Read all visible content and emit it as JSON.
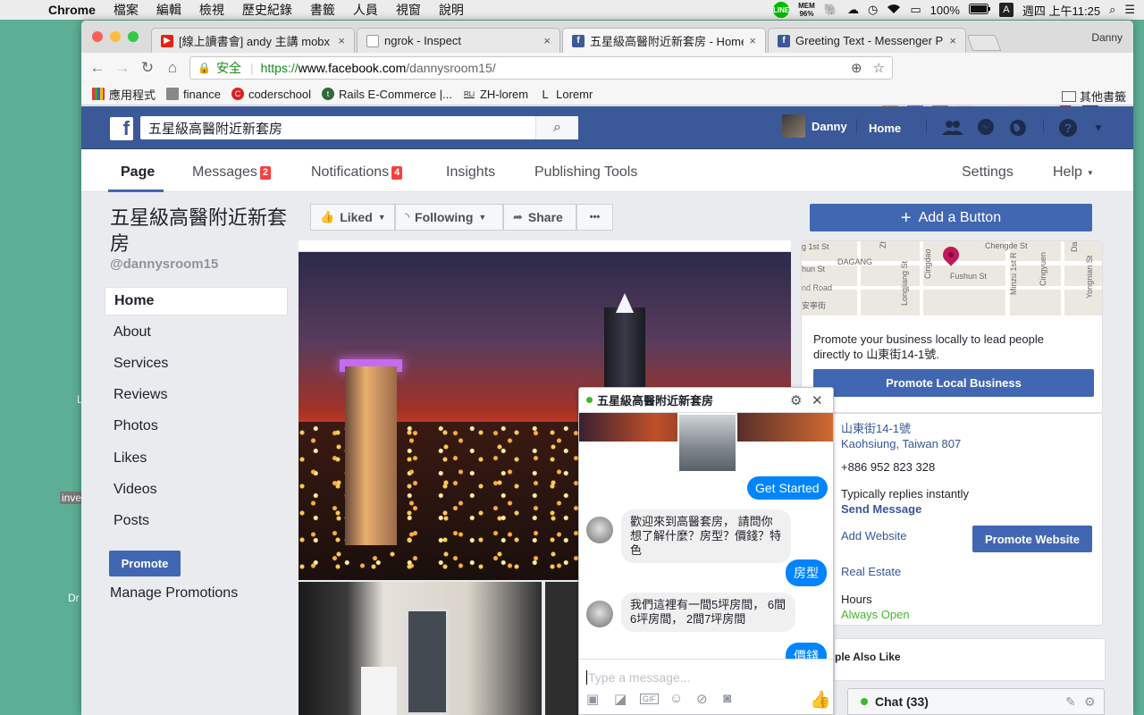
{
  "menubar": {
    "app": "Chrome",
    "items": [
      "檔案",
      "編輯",
      "檢視",
      "歷史紀錄",
      "書籤",
      "人員",
      "視窗",
      "說明"
    ],
    "line": "LINE",
    "mem_label": "MEM",
    "mem_value": "96%",
    "battery": "100%",
    "input_source": "A",
    "clock": "週四 上午11:25"
  },
  "desktop": {
    "labels": [
      "L",
      "inve",
      "Dr"
    ]
  },
  "browser": {
    "profile": "Danny",
    "tabs": [
      {
        "label": "[線上讀書會] andy 主講 mobx v",
        "icon": "youtube-icon",
        "color": "#e62117",
        "glyph": "▶",
        "active": false
      },
      {
        "label": "ngrok - Inspect",
        "icon": "page-icon",
        "color": "#9aa0a6",
        "glyph": "",
        "active": false
      },
      {
        "label": "五星級高醫附近新套房 - Home",
        "icon": "facebook-icon",
        "color": "#3b5998",
        "glyph": "f",
        "active": true
      },
      {
        "label": "Greeting Text - Messenger Pla",
        "icon": "facebook-icon",
        "color": "#3b5998",
        "glyph": "f",
        "active": false
      }
    ],
    "close_glyph": "×",
    "omnibox": {
      "secure_label": "安全",
      "protocol": "https://",
      "host": "www.facebook.com",
      "path": "/dannysroom15/"
    },
    "bookmarks": [
      {
        "label": "應用程式",
        "icon": "apps-grid-icon",
        "color": "#555"
      },
      {
        "label": "finance",
        "icon": "folder-icon",
        "color": "#777"
      },
      {
        "label": "coderschool",
        "icon": "coderschool-icon",
        "color": "#e02020"
      },
      {
        "label": "Rails E-Commerce |...",
        "icon": "rails-icon",
        "color": "#2f6b3a"
      },
      {
        "label": "ZH-lorem",
        "icon": "lorem-icon",
        "color": "#333"
      },
      {
        "label": "Loremr",
        "icon": "loremr-icon",
        "color": "#333"
      }
    ],
    "other_bookmarks": "其他書籤"
  },
  "fb": {
    "search_value": "五星級高醫附近新套房",
    "user_name": "Danny",
    "home_label": "Home",
    "page_nav": {
      "page": "Page",
      "messages": "Messages",
      "messages_count": "2",
      "notifications": "Notifications",
      "notifications_count": "4",
      "insights": "Insights",
      "publishing": "Publishing Tools",
      "settings": "Settings",
      "help": "Help"
    },
    "page": {
      "title": "五星級高醫附近新套房",
      "handle": "@dannysroom15",
      "nav": [
        "Home",
        "About",
        "Services",
        "Reviews",
        "Photos",
        "Likes",
        "Videos",
        "Posts"
      ],
      "promote": "Promote",
      "manage_promotions": "Manage Promotions"
    },
    "actions": {
      "liked": "Liked",
      "following": "Following",
      "share": "Share",
      "more": "•••",
      "add_button": "Add a Button"
    },
    "map": {
      "labels": [
        "g 1st St",
        "Chengde St",
        "DAGANG",
        "hun St",
        "Fushun St",
        "nd Road",
        "安寧街",
        "Zhiyou",
        "Longjiang St",
        "Cingdao",
        "Minzu 1st R",
        "Cingyuen",
        "Yongnian St",
        "Dalong"
      ]
    },
    "sidebar": {
      "promote_text": "Promote your business locally to lead people directly to 山東街14-1號.",
      "promote_local": "Promote Local Business",
      "address_line1": "山東街14-1號",
      "address_line2": "Kaohsiung, Taiwan 807",
      "phone": "+886 952 823 328",
      "replies": "Typically replies instantly",
      "send_message": "Send Message",
      "add_website": "Add Website",
      "promote_website": "Promote Website",
      "category": "Real Estate",
      "hours_label": "Hours",
      "hours_value": "Always Open",
      "people_also_like": "ple Also Like"
    },
    "messenger": {
      "title": "五星級高醫附近新套房",
      "get_started": "Get Started",
      "bot_1": "歡迎來到高醫套房， 請問你想了解什麼？房型？價錢？特色",
      "me_1": "房型",
      "bot_2": "我們這裡有一間5坪房間， 6間6坪房間， 2間7坪房間",
      "me_2": "價錢",
      "placeholder": "Type a message..."
    },
    "chat": {
      "label": "Chat (33)"
    }
  }
}
